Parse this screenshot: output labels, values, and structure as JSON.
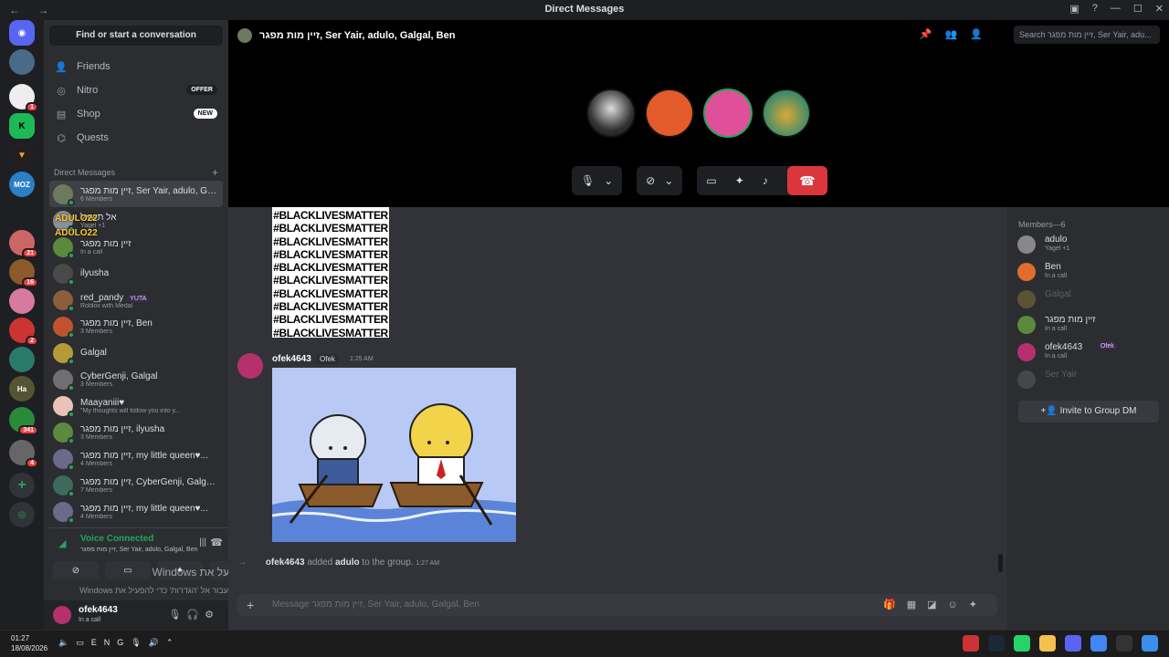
{
  "window": {
    "title": "Direct Messages",
    "nav": "← →"
  },
  "guilds": {
    "badges": [
      "1",
      "21",
      "16",
      "2",
      "341",
      "4"
    ]
  },
  "sidebar": {
    "find": "Find or start a conversation",
    "nav": [
      {
        "label": "Friends",
        "icon": "friends-icon",
        "pill": ""
      },
      {
        "label": "Nitro",
        "icon": "nitro-icon",
        "pill": "OFFER"
      },
      {
        "label": "Shop",
        "icon": "shop-icon",
        "pill": "NEW"
      },
      {
        "label": "Quests",
        "icon": "quests-icon",
        "pill": ""
      }
    ],
    "dm_header": "Direct Messages",
    "dms": [
      {
        "name": "זיין מות מפגר, Ser Yair, adulo, Galgal, Ben",
        "sub": "6 Members",
        "color": "#6d7a5e"
      },
      {
        "name": "אל תשאל",
        "sub": "Yagel +1",
        "color": "#8a8f99"
      },
      {
        "name": "זיין מות מפגר",
        "sub": "In a call",
        "color": "#5b8a3c"
      },
      {
        "name": "ilyusha",
        "sub": "",
        "color": "#4a4a4a"
      },
      {
        "name": "red_pandy",
        "sub": "Roblox with Medal",
        "color": "#8b5e3c",
        "tag": "YUTA"
      },
      {
        "name": "זיין מות מפגר, Ben",
        "sub": "3 Members",
        "color": "#c0532d"
      },
      {
        "name": "Galgal",
        "sub": "",
        "color": "#b59a3a"
      },
      {
        "name": "CyberGenji, Galgal",
        "sub": "3 Members",
        "color": "#707070"
      },
      {
        "name": "Maayaniii♥",
        "sub": "\"My thoughts will follow you into y...",
        "color": "#e8c4b8"
      },
      {
        "name": "זיין מות מפגר, ilyusha",
        "sub": "3 Members",
        "color": "#5b8a3c"
      },
      {
        "name": "זיין מות מפגר, my little queen♥...",
        "sub": "4 Members",
        "color": "#6a6a8a"
      },
      {
        "name": "זיין מות מפגר, CyberGenji, Galgal...",
        "sub": "7 Members",
        "color": "#3d6a5a"
      },
      {
        "name": "זיין מות מפגר, my little queen♥...",
        "sub": "4 Members",
        "color": "#6a6a8a"
      }
    ],
    "overlay_tags": [
      "ADULO22",
      "ADULO22"
    ],
    "voice": {
      "status": "Voice Connected",
      "channel": "זיין מות מפגר, Ser Yair, adulo, Galgal, Ben"
    },
    "user": {
      "name": "ofek4643",
      "status": "In a call"
    }
  },
  "watermark": {
    "line1": "הפעל את Windows",
    "line2": "עבור אל 'הגדרות' כדי להפעיל את Windows"
  },
  "call": {
    "title": "זיין מות מפגר, Ser Yair, adulo, Galgal, Ben",
    "search_placeholder": "Search זיין מות מפגר, Ser Yair, adu..."
  },
  "chat": {
    "blm_lines": [
      "#BLACKLIVESMATTER",
      "#BLACKLIVESMATTER",
      "#BLACKLIVESMATTER",
      "#BLACKLIVESMATTER",
      "#BLACKLIVESMATTER",
      "#BLACKLIVESMATTER",
      "#BLACKLIVESMATTER",
      "#BLACKLIVESMATTER",
      "#BLACKLIVESMATTER",
      "#BLACKLIVESMATTER"
    ],
    "message": {
      "author": "ofek4643",
      "badge": "Ofek",
      "time": "1:25 AM"
    },
    "system": {
      "actor": "ofek4643",
      "action": "added",
      "target": "adulo",
      "rest": "to the group.",
      "time": "1:27 AM"
    },
    "composer_placeholder": "Message זיין מות מפגר, Ser Yair, adulo, Galgal, Ben"
  },
  "members": {
    "header": "Members—6",
    "list": [
      {
        "name": "adulo",
        "sub": "Yagel +1",
        "color": "#888"
      },
      {
        "name": "Ben",
        "sub": "In a call",
        "color": "#e36b2c"
      },
      {
        "name": "Galgal",
        "sub": "",
        "color": "#b59a3a"
      },
      {
        "name": "זיין מות מפגר",
        "sub": "In a call",
        "color": "#5b8a3c"
      },
      {
        "name": "ofek4643",
        "sub": "In a call",
        "color": "#b5316d",
        "tag": "Ofek"
      },
      {
        "name": "Ser Yair",
        "sub": "",
        "color": "#777"
      }
    ],
    "invite": "Invite to Group DM"
  },
  "taskbar": {
    "time": "01:27",
    "date": "18/08/2026",
    "lang": "ENG"
  }
}
